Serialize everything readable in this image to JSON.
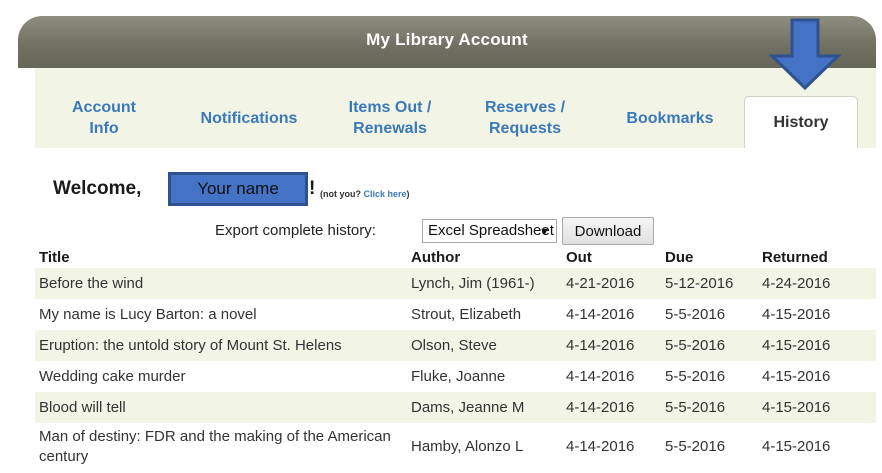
{
  "title": "My Library Account",
  "tabs": [
    {
      "line1": "Account",
      "line2": "Info"
    },
    {
      "line1": "Notifications",
      "line2": ""
    },
    {
      "line1": "Items Out /",
      "line2": "Renewals"
    },
    {
      "line1": "Reserves /",
      "line2": "Requests"
    },
    {
      "line1": "Bookmarks",
      "line2": ""
    },
    {
      "line1": "History",
      "line2": ""
    }
  ],
  "welcome": {
    "prefix": "Welcome,",
    "name_placeholder": "Your name",
    "suffix": "!",
    "not_you": "(not you?",
    "click_here": "Click here",
    "not_you_close": ")"
  },
  "export": {
    "label": "Export complete history:",
    "selected": "Excel Spreadsheet",
    "download_label": "Download"
  },
  "table": {
    "headers": [
      "Title",
      "Author",
      "Out",
      "Due",
      "Returned"
    ],
    "rows": [
      [
        "Before the wind",
        "Lynch, Jim (1961-)",
        "4-21-2016",
        "5-12-2016",
        "4-24-2016"
      ],
      [
        "My name is Lucy Barton: a novel",
        "Strout, Elizabeth",
        "4-14-2016",
        "5-5-2016",
        "4-15-2016"
      ],
      [
        "Eruption: the untold story of Mount St. Helens",
        "Olson, Steve",
        "4-14-2016",
        "5-5-2016",
        "4-15-2016"
      ],
      [
        "Wedding cake murder",
        "Fluke, Joanne",
        "4-14-2016",
        "5-5-2016",
        "4-15-2016"
      ],
      [
        "Blood will tell",
        "Dams, Jeanne M",
        "4-14-2016",
        "5-5-2016",
        "4-15-2016"
      ],
      [
        "Man of destiny: FDR and the making of the American century",
        "Hamby, Alonzo L",
        "4-14-2016",
        "5-5-2016",
        "4-15-2016"
      ]
    ]
  },
  "colors": {
    "accent": "#3a7ab8",
    "titlebar": "#6f6f62",
    "row_alt": "#f2f4e6",
    "annotation_fill": "#4472c4",
    "annotation_stroke": "#2f528f"
  },
  "annotation": {
    "icon": "arrow-down-icon"
  }
}
